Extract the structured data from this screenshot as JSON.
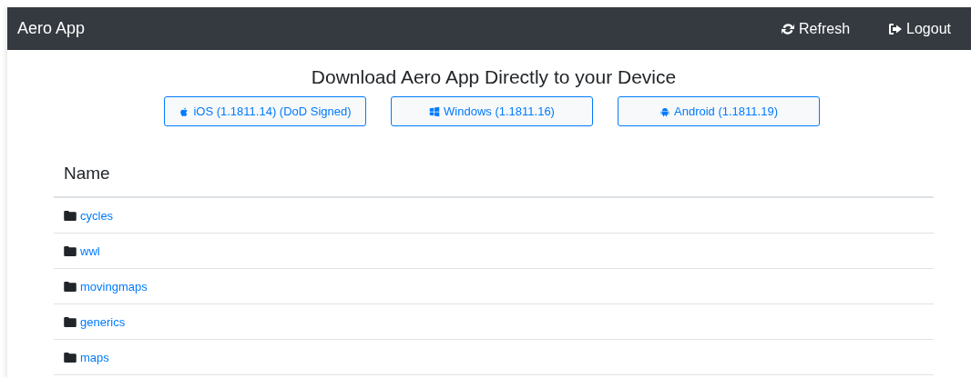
{
  "navbar": {
    "brand": "Aero App",
    "actions": [
      {
        "kind": "refresh",
        "label": "Refresh"
      },
      {
        "kind": "logout",
        "label": "Logout"
      }
    ]
  },
  "heading": "Download Aero App Directly to your Device",
  "downloads": [
    {
      "kind": "apple",
      "label": "iOS (1.1811.14) (DoD Signed)"
    },
    {
      "kind": "windows",
      "label": "Windows (1.1811.16)"
    },
    {
      "kind": "android",
      "label": "Android (1.1811.19)"
    }
  ],
  "table": {
    "columns": [
      "Name"
    ],
    "rows": [
      {
        "name": "cycles"
      },
      {
        "name": "wwl"
      },
      {
        "name": "movingmaps"
      },
      {
        "name": "generics"
      },
      {
        "name": "maps"
      }
    ]
  }
}
